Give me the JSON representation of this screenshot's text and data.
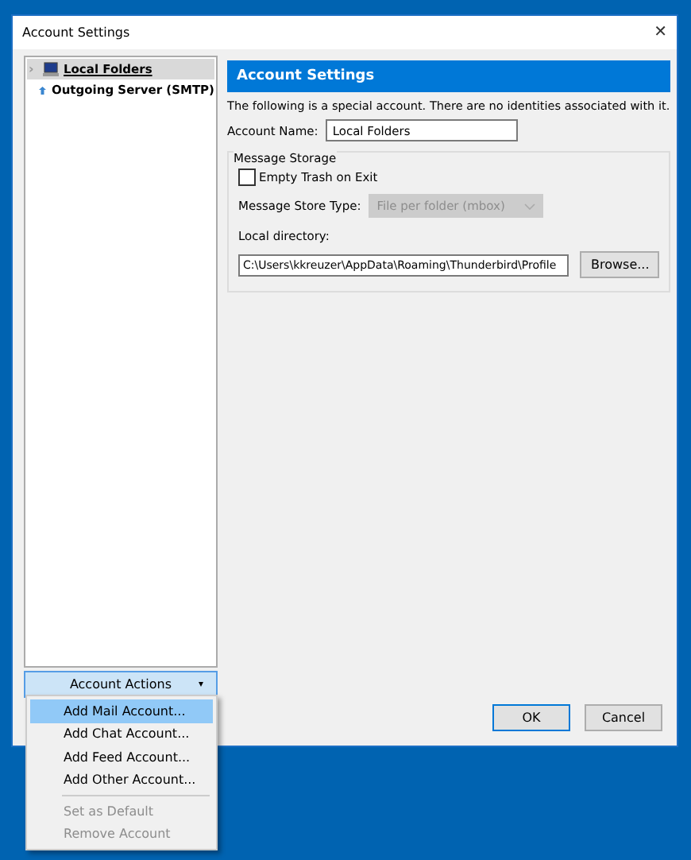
{
  "window": {
    "title": "Account Settings",
    "close": "✕"
  },
  "accounts": [
    {
      "label": "Local Folders",
      "kind": "local",
      "selected": true,
      "expander": "›"
    },
    {
      "label": "Outgoing Server (SMTP)",
      "kind": "smtp",
      "selected": false
    }
  ],
  "account_actions": {
    "label": "Account Actions",
    "caret": "▾",
    "expanded": true,
    "menu": [
      {
        "label": "Add Mail Account...",
        "disabled": false,
        "selected": true
      },
      {
        "label": "Add Chat Account...",
        "disabled": false,
        "selected": false
      },
      {
        "label": "Add Feed Account...",
        "disabled": false,
        "selected": false
      },
      {
        "label": "Add Other Account...",
        "disabled": false,
        "selected": false
      },
      {
        "kind": "separator"
      },
      {
        "label": "Set as Default",
        "disabled": true,
        "selected": false
      },
      {
        "label": "Remove Account",
        "disabled": true,
        "selected": false
      }
    ]
  },
  "panel": {
    "title": "Account Settings",
    "description": "The following is a special account. There are no identities associated with it.",
    "account_name_label": "Account Name:",
    "account_name": "Local Folders",
    "storage": {
      "title": "Message Storage",
      "empty_trash": {
        "label": "Empty Trash on Exit",
        "checked": false
      },
      "store_type_label": "Message Store Type:",
      "store_type": {
        "value": "File per folder (mbox)",
        "disabled": true
      },
      "local_directory_label": "Local directory:",
      "local_directory": "C:\\Users\\kkreuzer\\AppData\\Roaming\\Thunderbird\\Profile",
      "browse": "Browse..."
    }
  },
  "buttons": [
    {
      "label": "OK",
      "default": true
    },
    {
      "label": "Cancel",
      "default": false
    }
  ]
}
